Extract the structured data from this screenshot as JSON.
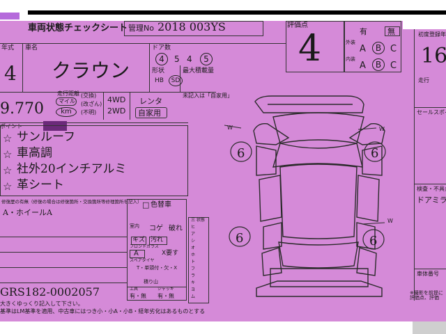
{
  "header": {
    "title": "車両状態チェックシート",
    "mgmt_label": "管理No",
    "mgmt_value": "2018 003YS",
    "grade_label": "評価点",
    "grade_value": "4"
  },
  "year": {
    "label": "年式",
    "value": "4"
  },
  "model": {
    "label": "車名",
    "value": "クラウン"
  },
  "doors": {
    "label": "ドア数",
    "values": [
      "4",
      "5",
      "4",
      "5"
    ]
  },
  "shift": {
    "label": "形状",
    "opt1": "HB",
    "opt2": "SD"
  },
  "capacity_label": "最大積載量",
  "mileage": {
    "value": "9.770",
    "unit1": "マイル",
    "unit2": "km",
    "unit_label": "走行距離",
    "checks": [
      "(交換)",
      "(改ざん)",
      "(不明)"
    ]
  },
  "drive": {
    "opt1": "4WD",
    "opt2": "2WD"
  },
  "use": {
    "opt1": "レンタ",
    "opt2": "自家用",
    "note": "未記入は「自家用」"
  },
  "points": {
    "label": "ポイント",
    "items": [
      "サンルーフ",
      "車高調",
      "社外20インチアルミ",
      "革シート"
    ],
    "star": "☆"
  },
  "remarks": {
    "label": "修復歴の有無（修復の場合は修復箇所・交換箇所等修理箇所を記入）",
    "text": "A・ホイールA"
  },
  "color_change": {
    "label": "色替車",
    "checkbox": "□"
  },
  "interior": {
    "label": "室内",
    "rows": [
      "コゲ",
      "破れ"
    ],
    "tags": [
      "キズ",
      "汚れ"
    ],
    "grade": "A",
    "x_label": "X要す"
  },
  "frontglass": {
    "label": "フロントガラス"
  },
  "spare": {
    "label": "スペアタイヤ",
    "opts": "T・单頭付・欠・X",
    "sub": "積り山"
  },
  "tools": {
    "label": "工具",
    "opts": "有・無"
  },
  "jack": {
    "label": "ジャッキ",
    "opts": "有・無"
  },
  "vin": "GRS182-0002057",
  "footer": {
    "line1": "大きくゆっくり記入して下さい。",
    "line2": "基準はLM基準を適用、中古車にはつき小・小A・小B・経年劣化はあるものとする"
  },
  "condition": {
    "top_label": "有",
    "top_option": "無",
    "row1_label": "外装",
    "row2_label": "内装",
    "grades": [
      "A",
      "B",
      "C"
    ],
    "row1_circled": "B",
    "row2_circled": "B"
  },
  "first_reg": {
    "label": "初度登録年",
    "value": "16"
  },
  "travel_label": "走行",
  "sales_point_label": "セールスポイ",
  "inspector": {
    "label": "検査・不具合",
    "text": "ドアミラー"
  },
  "car_body_label": "車体番号",
  "note_bottom": "※撮影を前提に評価点、評価",
  "diagram": {
    "marks": [
      "6",
      "6",
      "6",
      "6"
    ],
    "annotations": [
      "W",
      "W",
      "W"
    ]
  },
  "checklist_items": [
    "三 状態",
    "ヒ",
    "ア",
    "シ",
    "オ",
    "ホ",
    "ト",
    "フ",
    "ラ",
    "キ",
    "ヨ",
    "ム"
  ]
}
